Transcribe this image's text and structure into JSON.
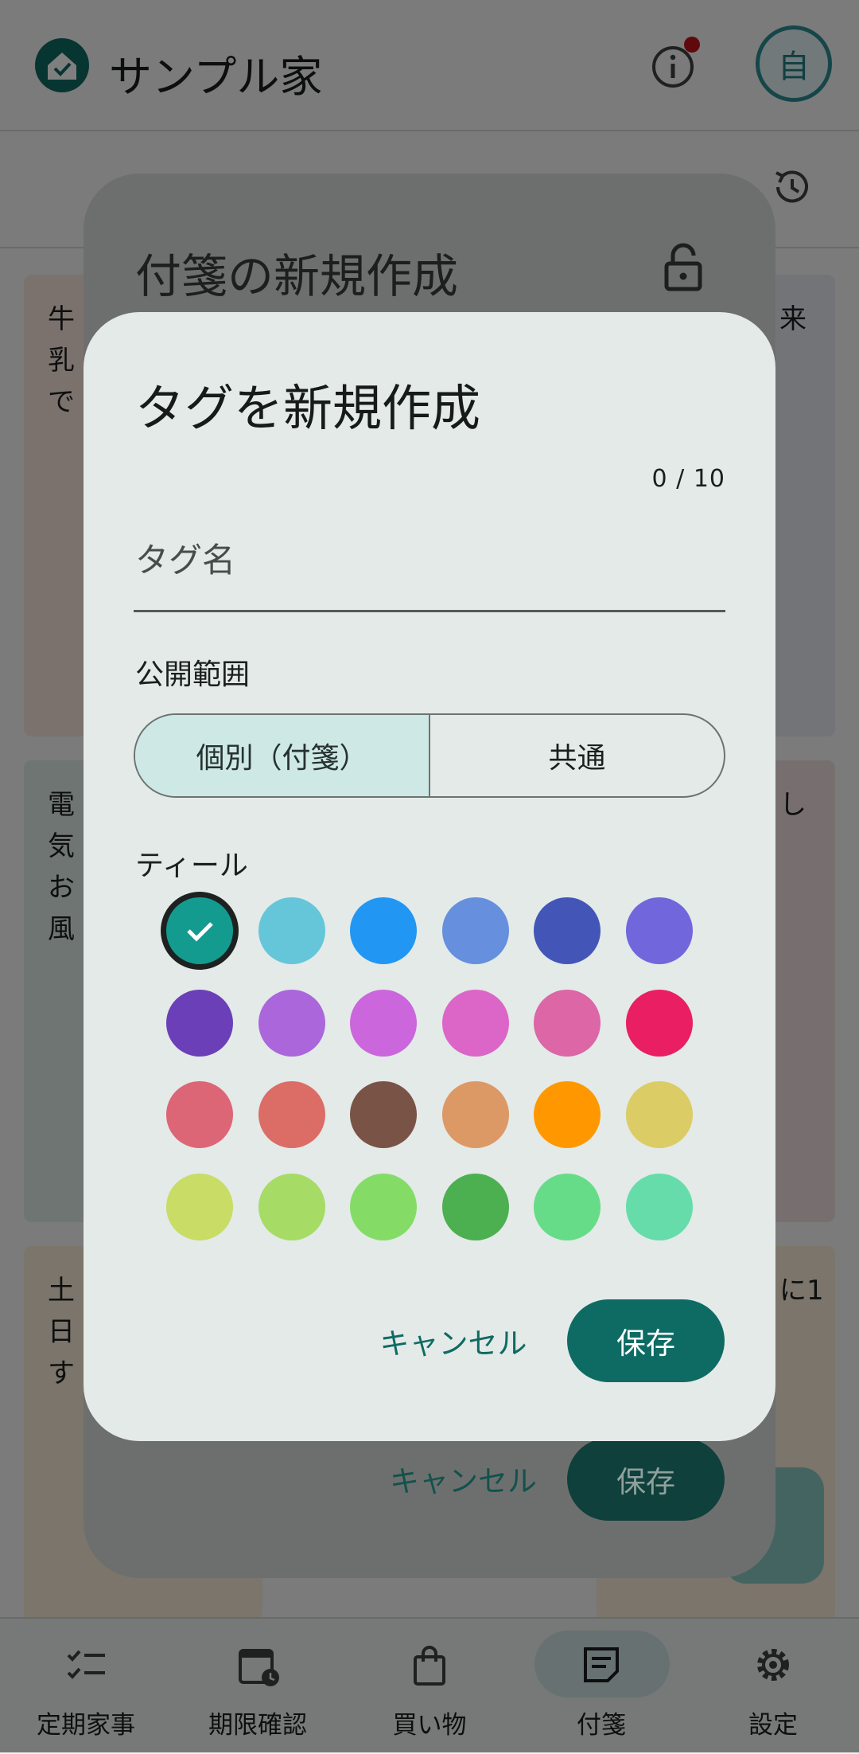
{
  "app": {
    "title": "サンプル家",
    "avatar_label": "自"
  },
  "cards": [
    {
      "text": "牛乳で",
      "color": "#f7e4dd"
    },
    {
      "text": "電気お風",
      "color": "#dfeae6"
    },
    {
      "text": "土日す",
      "color": "#f7ebd7"
    },
    {
      "text": "来",
      "color": "#e6e9f0"
    },
    {
      "text": "し",
      "color": "#eedfde"
    },
    {
      "text": "に1",
      "color": "#f7ebd7"
    }
  ],
  "nav": {
    "items": [
      {
        "label": "定期家事",
        "icon": "checklist-icon"
      },
      {
        "label": "期限確認",
        "icon": "calendar-clock-icon"
      },
      {
        "label": "買い物",
        "icon": "shopping-bag-icon"
      },
      {
        "label": "付箋",
        "icon": "sticky-note-icon"
      },
      {
        "label": "設定",
        "icon": "gear-icon"
      }
    ],
    "selected_index": 3
  },
  "note_dialog": {
    "title": "付箋の新規作成",
    "cancel_label": "キャンセル",
    "save_label": "保存"
  },
  "tag_dialog": {
    "title": "タグを新規作成",
    "counter": "0 / 10",
    "tag_name_placeholder": "タグ名",
    "tag_name_value": "",
    "scope_label": "公開範囲",
    "scope_options": [
      "個別（付箋）",
      "共通"
    ],
    "scope_selected_index": 0,
    "selected_color_name": "ティール",
    "colors": [
      "#139b90",
      "#66c6d9",
      "#2196f3",
      "#6690dd",
      "#4356b8",
      "#7266dc",
      "#6b3fb8",
      "#ab66dc",
      "#cb66dc",
      "#dc66c8",
      "#dc66a6",
      "#e91e63",
      "#dc6675",
      "#dc6c66",
      "#7a5347",
      "#dc9966",
      "#ff9800",
      "#dccc66",
      "#c8dc66",
      "#a6dc66",
      "#84dc66",
      "#4caf50",
      "#66dc88",
      "#66dcaa"
    ],
    "selected_color_index": 0,
    "cancel_label": "キャンセル",
    "save_label": "保存"
  },
  "theme": {
    "accent": "#0d6b63",
    "dialog_bg": "#e3eae8"
  }
}
